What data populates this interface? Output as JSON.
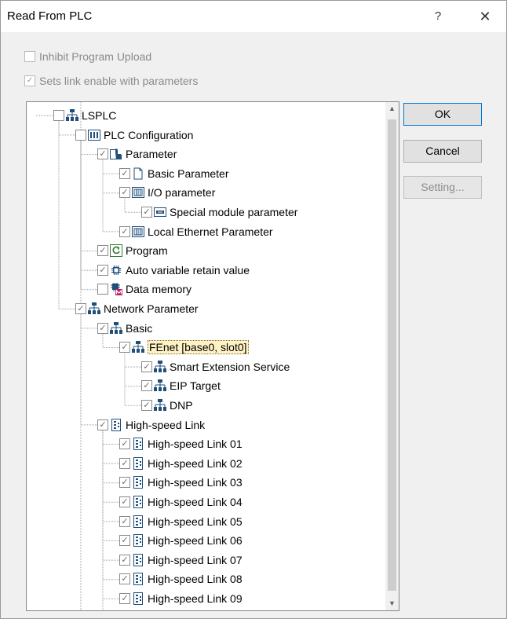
{
  "window": {
    "title": "Read From PLC",
    "help_glyph": "?",
    "close_glyph": "✕"
  },
  "options": {
    "inhibit_label": "Inhibit Program Upload",
    "inhibit_checked": false,
    "sets_link_label": "Sets link enable with parameters",
    "sets_link_checked": true
  },
  "buttons": {
    "ok": "OK",
    "cancel": "Cancel",
    "setting": "Setting..."
  },
  "tree": [
    {
      "label": "LSPLC",
      "checked": false,
      "icon": "network-icon"
    },
    {
      "label": "PLC Configuration",
      "checked": false,
      "icon": "plc-config-icon"
    },
    {
      "label": "Parameter",
      "checked": true,
      "icon": "parameter-icon"
    },
    {
      "label": "Basic Parameter",
      "checked": true,
      "icon": "document-icon"
    },
    {
      "label": "I/O parameter",
      "checked": true,
      "icon": "io-module-icon"
    },
    {
      "label": "Special module parameter",
      "checked": true,
      "icon": "special-module-icon"
    },
    {
      "label": "Local Ethernet Parameter",
      "checked": true,
      "icon": "io-module-icon"
    },
    {
      "label": "Program",
      "checked": true,
      "icon": "program-icon"
    },
    {
      "label": "Auto variable retain value",
      "checked": true,
      "icon": "chip-icon"
    },
    {
      "label": "Data memory",
      "checked": false,
      "icon": "data-memory-icon"
    },
    {
      "label": "Network Parameter",
      "checked": true,
      "icon": "network-icon"
    },
    {
      "label": "Basic",
      "checked": true,
      "icon": "network-icon"
    },
    {
      "label": "FEnet [base0, slot0]",
      "checked": true,
      "icon": "network-icon",
      "selected": true
    },
    {
      "label": "Smart Extension Service",
      "checked": true,
      "icon": "network-icon"
    },
    {
      "label": "EIP Target",
      "checked": true,
      "icon": "network-icon"
    },
    {
      "label": "DNP",
      "checked": true,
      "icon": "network-icon"
    },
    {
      "label": "High-speed Link",
      "checked": true,
      "icon": "link-module-icon"
    },
    {
      "label": "High-speed Link 01",
      "checked": true,
      "icon": "link-module-icon"
    },
    {
      "label": "High-speed Link 02",
      "checked": true,
      "icon": "link-module-icon"
    },
    {
      "label": "High-speed Link 03",
      "checked": true,
      "icon": "link-module-icon"
    },
    {
      "label": "High-speed Link 04",
      "checked": true,
      "icon": "link-module-icon"
    },
    {
      "label": "High-speed Link 05",
      "checked": true,
      "icon": "link-module-icon"
    },
    {
      "label": "High-speed Link 06",
      "checked": true,
      "icon": "link-module-icon"
    },
    {
      "label": "High-speed Link 07",
      "checked": true,
      "icon": "link-module-icon"
    },
    {
      "label": "High-speed Link 08",
      "checked": true,
      "icon": "link-module-icon"
    },
    {
      "label": "High-speed Link 09",
      "checked": true,
      "icon": "link-module-icon"
    }
  ],
  "colors": {
    "accent": "#0078d7",
    "selection": "#fff3c6",
    "icon": "#1f4e79"
  }
}
